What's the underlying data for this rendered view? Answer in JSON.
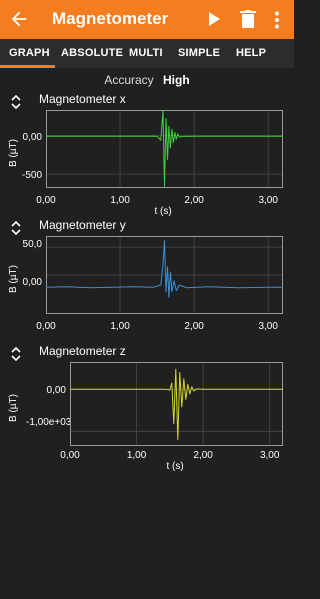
{
  "appbar": {
    "title": "Magnetometer",
    "back_icon": "arrow-back-icon",
    "play_icon": "play-icon",
    "delete_icon": "trash-icon",
    "more_icon": "more-vert-icon",
    "accent_color": "#f37d1f"
  },
  "tabs": [
    "GRAPH",
    "ABSOLUTE",
    "MULTI",
    "SIMPLE",
    "HELP"
  ],
  "active_tab": "GRAPH",
  "accuracy": {
    "label": "Accuracy",
    "value": "High"
  },
  "chart_data": [
    {
      "type": "line",
      "title": "Magnetometer x",
      "xlabel": "t (s)",
      "ylabel": "B (µT)",
      "color": "#3fd13f",
      "xlim": [
        0,
        3.2
      ],
      "ylim": [
        -680,
        330
      ],
      "xticks": [
        0,
        1,
        2,
        3
      ],
      "xtick_labels": [
        "0,00",
        "1,00",
        "2,00",
        "3,00"
      ],
      "yticks": [
        0,
        -500
      ],
      "ytick_labels": [
        "0,00",
        "-500"
      ],
      "x": [
        0,
        1.4,
        1.5,
        1.55,
        1.58,
        1.6,
        1.62,
        1.64,
        1.66,
        1.68,
        1.7,
        1.72,
        1.74,
        1.76,
        1.78,
        1.8,
        1.85,
        2.0,
        3.2
      ],
      "y": [
        -10,
        -10,
        -10,
        -60,
        320,
        -660,
        220,
        -310,
        120,
        -160,
        80,
        -90,
        40,
        -50,
        20,
        -20,
        -12,
        -10,
        -10
      ]
    },
    {
      "type": "line",
      "title": "Magnetometer y",
      "xlabel": "",
      "ylabel": "B (µT)",
      "color": "#3d8fd6",
      "xlim": [
        0,
        3.2
      ],
      "ylim": [
        -70,
        70
      ],
      "xticks": [
        0,
        1,
        2,
        3
      ],
      "xtick_labels": [
        "0,00",
        "1,00",
        "2,00",
        "3,00"
      ],
      "yticks": [
        50,
        0
      ],
      "ytick_labels": [
        "50,0",
        "0,00"
      ],
      "x": [
        0,
        0.3,
        0.6,
        0.9,
        1.2,
        1.45,
        1.55,
        1.58,
        1.6,
        1.62,
        1.64,
        1.66,
        1.68,
        1.7,
        1.73,
        1.76,
        1.8,
        1.9,
        2.2,
        2.6,
        3.0,
        3.2
      ],
      "y": [
        -22,
        -21,
        -23,
        -22,
        -21,
        -22,
        -18,
        20,
        62,
        -30,
        15,
        -40,
        5,
        -30,
        -10,
        -28,
        -18,
        -23,
        -21,
        -23,
        -22,
        -22
      ]
    },
    {
      "type": "line",
      "title": "Magnetometer z",
      "xlabel": "t (s)",
      "ylabel": "B (µT)",
      "color": "#d6d62c",
      "xlim": [
        0,
        3.2
      ],
      "ylim": [
        -1350,
        650
      ],
      "xticks": [
        0,
        1,
        2,
        3
      ],
      "xtick_labels": [
        "0,00",
        "1,00",
        "2,00",
        "3,00"
      ],
      "yticks": [
        0,
        -1000
      ],
      "ytick_labels": [
        "0,00",
        "-1,00e+03"
      ],
      "x": [
        0,
        1.45,
        1.5,
        1.53,
        1.56,
        1.59,
        1.62,
        1.65,
        1.68,
        1.71,
        1.74,
        1.77,
        1.8,
        1.83,
        1.86,
        1.9,
        2.0,
        3.2
      ],
      "y": [
        0,
        0,
        -20,
        150,
        -820,
        480,
        -1200,
        400,
        -420,
        250,
        -240,
        120,
        -110,
        60,
        -40,
        10,
        0,
        0
      ]
    }
  ]
}
